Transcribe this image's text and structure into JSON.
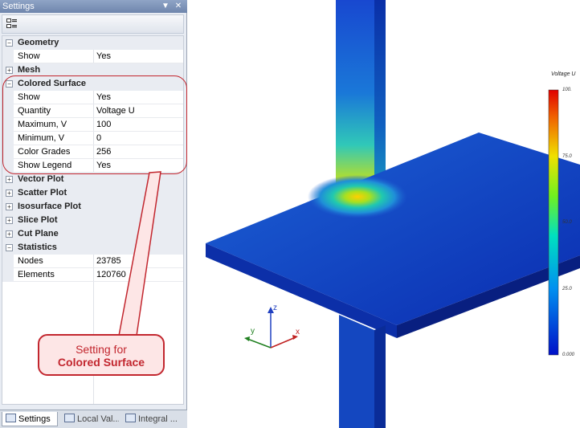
{
  "panel": {
    "title": "Settings",
    "rows": [
      {
        "kind": "cat",
        "label": "Geometry",
        "expanded": true
      },
      {
        "kind": "prop",
        "key": "Show",
        "value": "Yes"
      },
      {
        "kind": "cat",
        "label": "Mesh",
        "expanded": false
      },
      {
        "kind": "cat",
        "label": "Colored Surface",
        "expanded": true
      },
      {
        "kind": "prop",
        "key": "Show",
        "value": "Yes"
      },
      {
        "kind": "prop",
        "key": "Quantity",
        "value": "Voltage U"
      },
      {
        "kind": "prop",
        "key": "Maximum, V",
        "value": "100"
      },
      {
        "kind": "prop",
        "key": "Minimum, V",
        "value": "0"
      },
      {
        "kind": "prop",
        "key": "Color Grades",
        "value": "256"
      },
      {
        "kind": "prop",
        "key": "Show Legend",
        "value": "Yes"
      },
      {
        "kind": "cat",
        "label": "Vector Plot",
        "expanded": false
      },
      {
        "kind": "cat",
        "label": "Scatter Plot",
        "expanded": false
      },
      {
        "kind": "cat",
        "label": "Isosurface Plot",
        "expanded": false
      },
      {
        "kind": "cat",
        "label": "Slice Plot",
        "expanded": false
      },
      {
        "kind": "cat",
        "label": "Cut Plane",
        "expanded": false
      },
      {
        "kind": "cat",
        "label": "Statistics",
        "expanded": true
      },
      {
        "kind": "prop",
        "key": "Nodes",
        "value": "23785"
      },
      {
        "kind": "prop",
        "key": "Elements",
        "value": "120760"
      }
    ],
    "tabs": [
      {
        "label": "Settings",
        "active": true
      },
      {
        "label": "Local Val...",
        "active": false
      },
      {
        "label": "Integral ...",
        "active": false
      }
    ]
  },
  "callout": {
    "line1": "Setting for",
    "line2": "Colored Surface"
  },
  "legend": {
    "title": "Voltage U",
    "ticks": [
      "100.",
      "75.0",
      "50.0",
      "25.0",
      "0.000"
    ]
  },
  "axes": {
    "x": "x",
    "y": "y",
    "z": "z"
  },
  "colors": {
    "accent": "#c2262e",
    "panel": "#e8ecf3",
    "titlebar": "#7f95bb"
  }
}
